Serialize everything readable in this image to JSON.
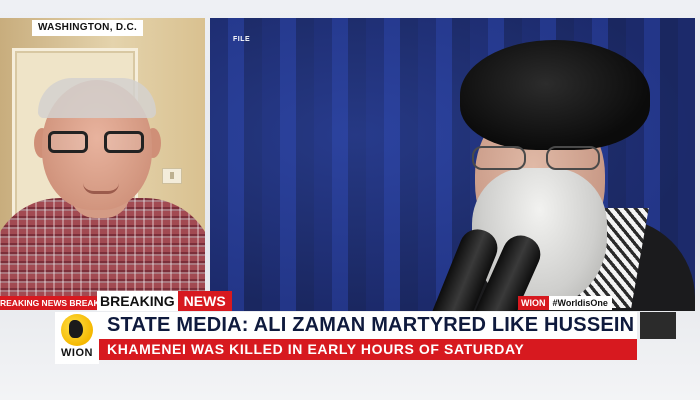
{
  "location": {
    "label": "WASHINGTON, D.C."
  },
  "file_label": "FILE",
  "ticker": {
    "text": "REAKING NEWS  BREAKING NEWS"
  },
  "breaking": {
    "word1": "BREAKING",
    "word2": "NEWS"
  },
  "headline": {
    "main": "STATE MEDIA: ALI ZAMAN MARTYRED LIKE HUSSEIN",
    "sub": "KHAMENEI WAS KILLED IN EARLY HOURS OF SATURDAY"
  },
  "channel": {
    "logo_text": "WION",
    "hashtag_brand": "WION",
    "hashtag": "#WorldisOne"
  },
  "colors": {
    "brand_red": "#d7191f",
    "headline_navy": "#0f1a3d",
    "logo_yellow": "#f5b800"
  }
}
